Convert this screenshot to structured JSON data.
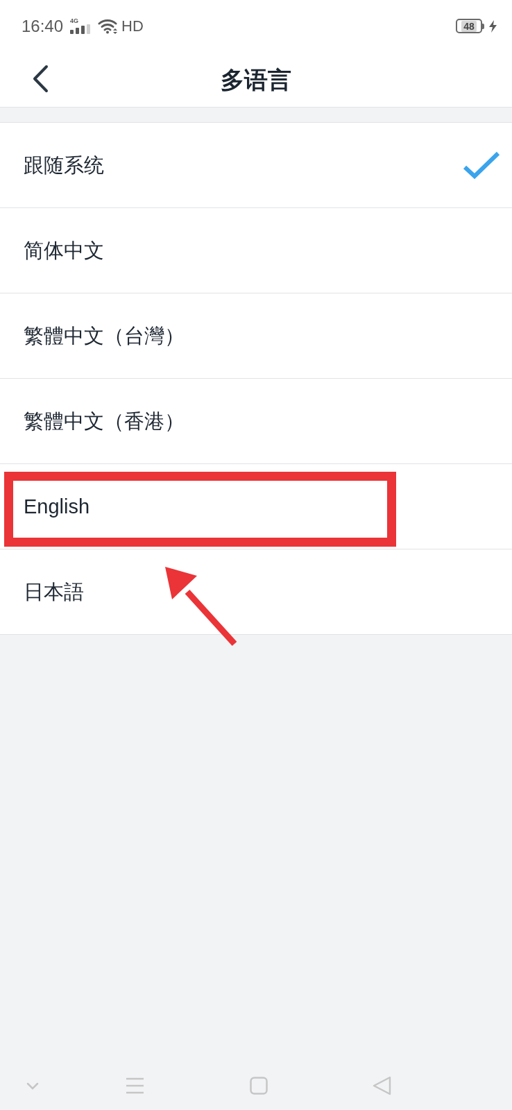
{
  "status_bar": {
    "time": "16:40",
    "network": "4G",
    "wifi_label": "HD",
    "battery": "48"
  },
  "header": {
    "title": "多语言"
  },
  "languages": [
    {
      "label": "跟随系统",
      "selected": true,
      "highlighted": false
    },
    {
      "label": "简体中文",
      "selected": false,
      "highlighted": false
    },
    {
      "label": "繁體中文（台灣）",
      "selected": false,
      "highlighted": false
    },
    {
      "label": "繁體中文（香港）",
      "selected": false,
      "highlighted": false
    },
    {
      "label": "English",
      "selected": false,
      "highlighted": true
    },
    {
      "label": "日本語",
      "selected": false,
      "highlighted": false
    }
  ]
}
